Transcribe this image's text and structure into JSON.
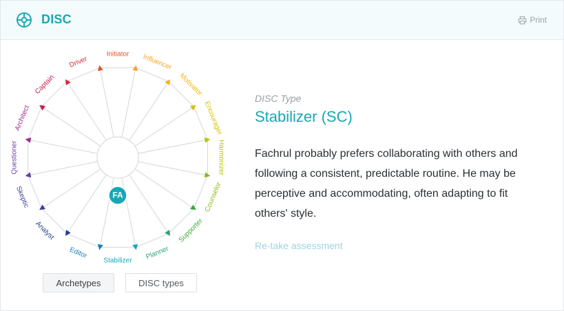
{
  "header": {
    "title": "DISC",
    "print_label": "Print",
    "accent": "#17a8b5"
  },
  "wheel": {
    "user_initials": "FA",
    "highlight_archetype": "Stabilizer",
    "archetypes": [
      {
        "label": "Initiator",
        "color": "#e0562b"
      },
      {
        "label": "Influencer",
        "color": "#f5a623"
      },
      {
        "label": "Motivator",
        "color": "#f2b705"
      },
      {
        "label": "Encourager",
        "color": "#d8c000"
      },
      {
        "label": "Harmonizer",
        "color": "#b7c800"
      },
      {
        "label": "Counselor",
        "color": "#8dbb12"
      },
      {
        "label": "Supporter",
        "color": "#3aaa35"
      },
      {
        "label": "Planner",
        "color": "#2f9e7a"
      },
      {
        "label": "Stabilizer",
        "color": "#17a8b5"
      },
      {
        "label": "Editor",
        "color": "#1b7fb8"
      },
      {
        "label": "Analyst",
        "color": "#1f3f88"
      },
      {
        "label": "Skeptic",
        "color": "#3a3f98"
      },
      {
        "label": "Questioner",
        "color": "#6b3fa0"
      },
      {
        "label": "Architect",
        "color": "#9b2f8c"
      },
      {
        "label": "Captain",
        "color": "#c71b4a"
      },
      {
        "label": "Driver",
        "color": "#d8283a"
      }
    ]
  },
  "result": {
    "type_label": "DISC Type",
    "type_value": "Stabilizer (SC)",
    "description": "Fachrul probably prefers collaborating with others and following a consistent, predictable routine. He may be perceptive and accommodating, often adapting to fit others' style.",
    "retake_label": "Re-take assessment"
  },
  "tabs": {
    "archetypes_label": "Archetypes",
    "disc_types_label": "DISC types"
  }
}
